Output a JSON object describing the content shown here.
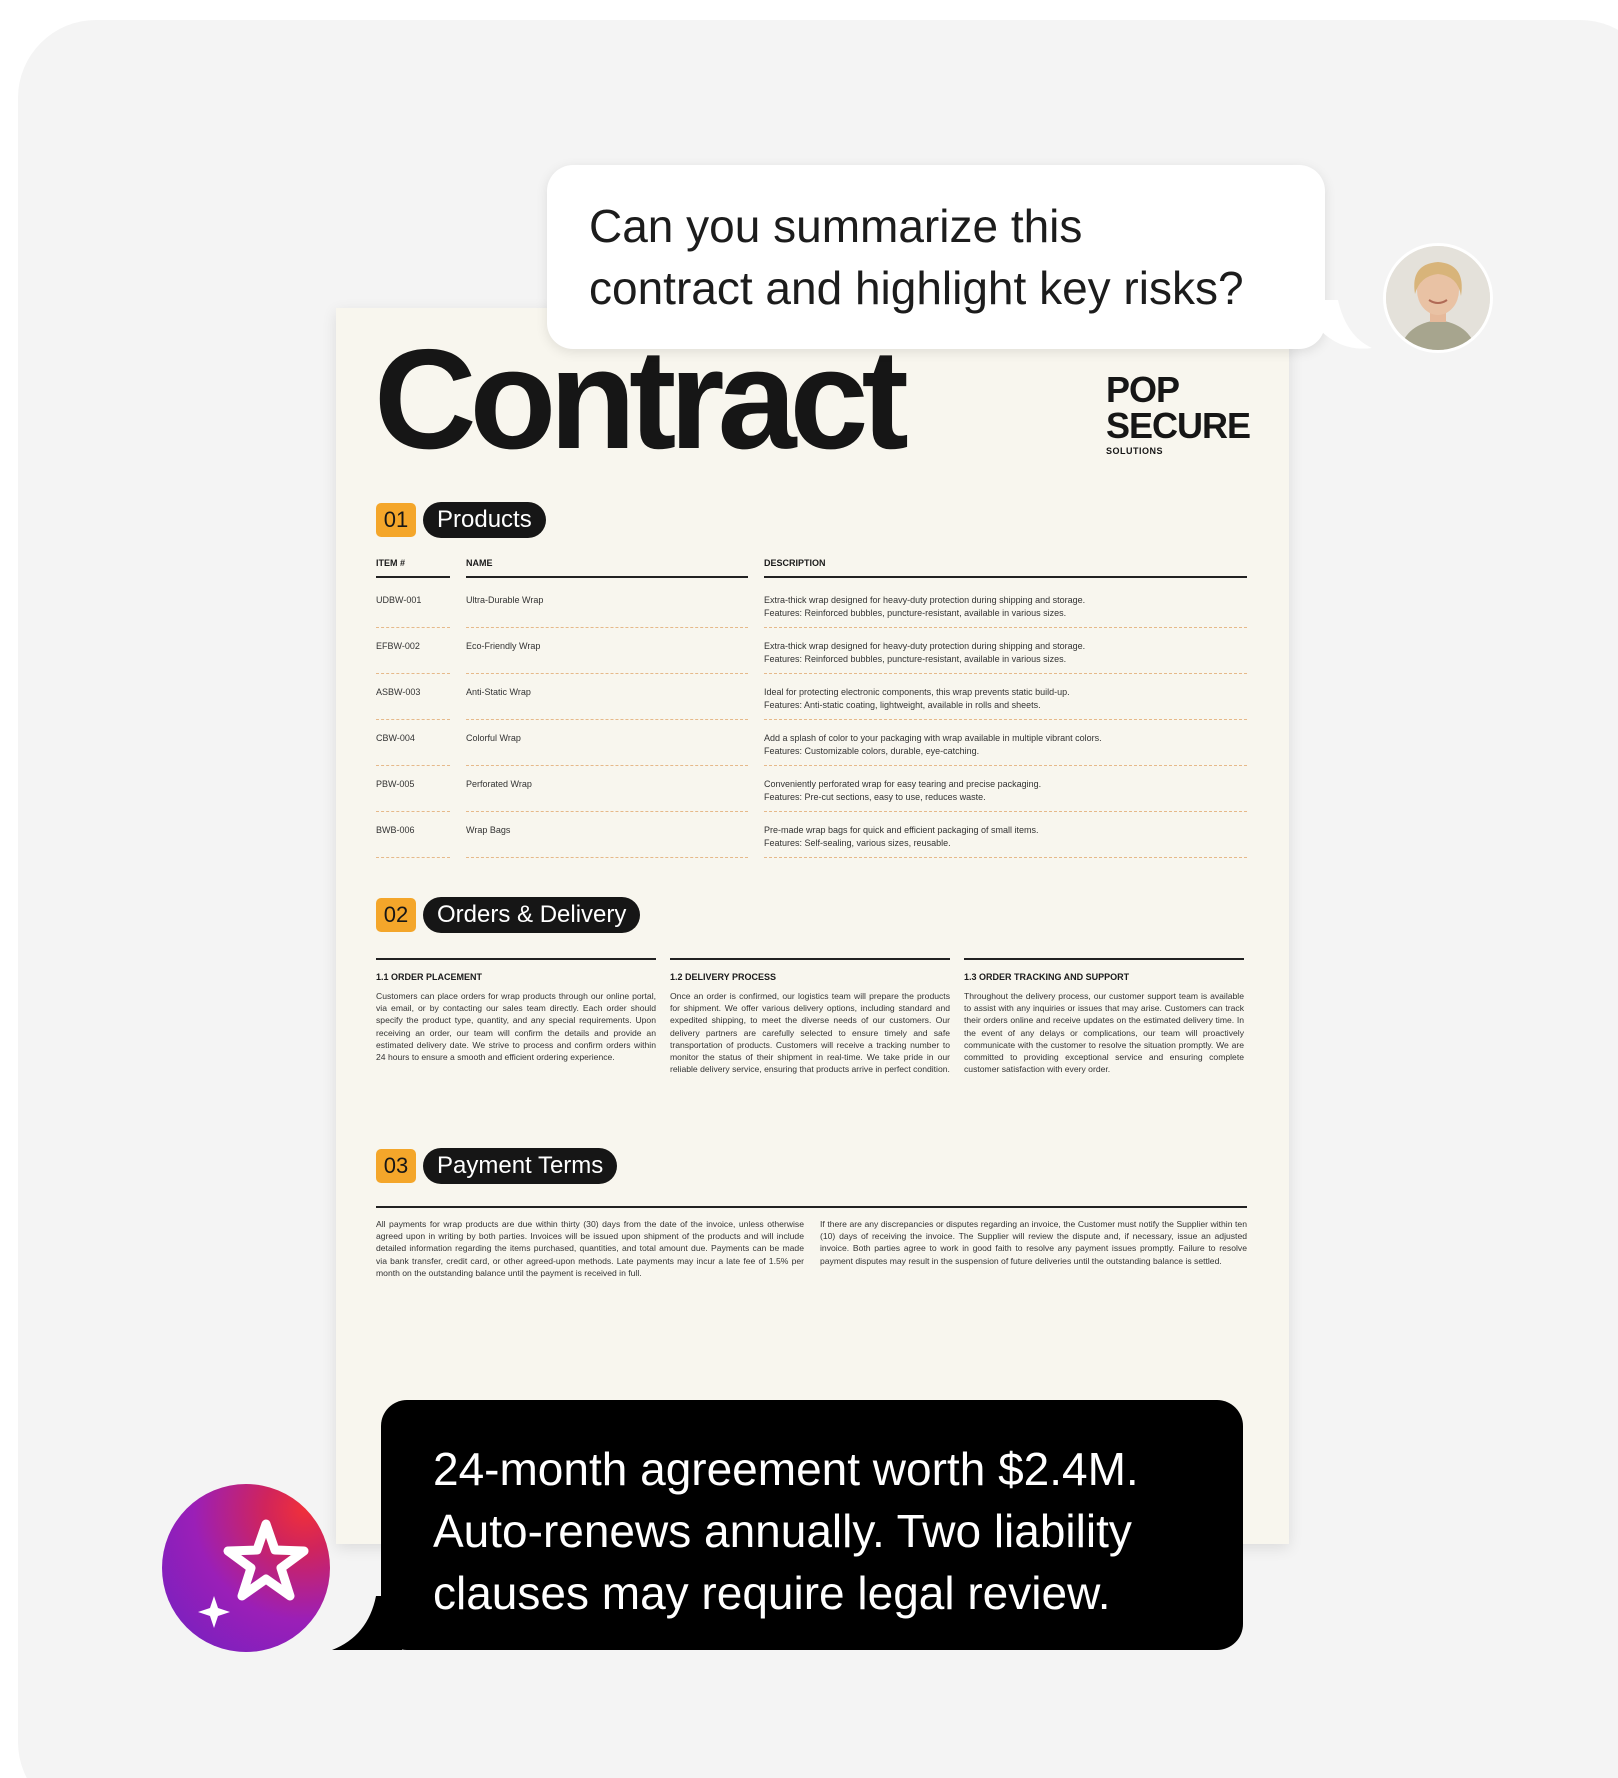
{
  "document": {
    "title": "Contract",
    "logo": {
      "line1": "POP",
      "line2": "SECURE",
      "line3": "SOLUTIONS"
    },
    "sections": [
      {
        "number": "01",
        "title": "Products"
      },
      {
        "number": "02",
        "title": "Orders & Delivery"
      },
      {
        "number": "03",
        "title": "Payment Terms"
      }
    ],
    "products": {
      "headers": [
        "ITEM #",
        "NAME",
        "DESCRIPTION"
      ],
      "rows": [
        {
          "item": "UDBW-001",
          "name": "Ultra-Durable Wrap",
          "desc1": "Extra-thick wrap designed for heavy-duty protection during shipping and storage.",
          "desc2": "Features: Reinforced bubbles, puncture-resistant, available in various sizes."
        },
        {
          "item": "EFBW-002",
          "name": "Eco-Friendly Wrap",
          "desc1": "Extra-thick wrap designed for heavy-duty protection during shipping and storage.",
          "desc2": "Features: Reinforced bubbles, puncture-resistant, available in various sizes."
        },
        {
          "item": "ASBW-003",
          "name": "Anti-Static Wrap",
          "desc1": "Ideal for protecting electronic components, this wrap prevents static build-up.",
          "desc2": "Features: Anti-static coating, lightweight, available in rolls and sheets."
        },
        {
          "item": "CBW-004",
          "name": "Colorful Wrap",
          "desc1": "Add a splash of color to your packaging with wrap available in multiple vibrant colors.",
          "desc2": "Features: Customizable colors, durable, eye-catching."
        },
        {
          "item": "PBW-005",
          "name": "Perforated Wrap",
          "desc1": "Conveniently perforated wrap for easy tearing and precise packaging.",
          "desc2": "Features: Pre-cut sections, easy to use, reduces waste."
        },
        {
          "item": "BWB-006",
          "name": "Wrap Bags",
          "desc1": "Pre-made wrap bags for quick and efficient packaging of small items.",
          "desc2": "Features: Self-sealing, various sizes, reusable."
        }
      ]
    },
    "orders": [
      {
        "title": "1.1  ORDER PLACEMENT",
        "body": "Customers can place orders for wrap products through our online portal, via email, or by contacting our sales team directly. Each order should specify the product type, quantity, and any special requirements. Upon receiving an order, our team will confirm the details and provide an estimated delivery date. We strive to process and confirm orders within 24 hours to ensure a smooth and efficient ordering experience."
      },
      {
        "title": "1.2  DELIVERY PROCESS",
        "body": "Once an order is confirmed, our logistics team will prepare the products for shipment. We offer various delivery options, including standard and expedited shipping, to meet the diverse needs of our customers. Our delivery partners are carefully selected to ensure timely and safe transportation of products. Customers will receive a tracking number to monitor the status of their shipment in real-time. We take pride in our reliable delivery service, ensuring that products arrive in perfect condition."
      },
      {
        "title": "1.3  ORDER TRACKING AND SUPPORT",
        "body": "Throughout the delivery process, our customer support team is available to assist with any inquiries or issues that may arise. Customers can track their orders online and receive updates on the estimated delivery time. In the event of any delays or complications, our team will proactively communicate with the customer to resolve the situation promptly. We are committed to providing exceptional service and ensuring complete customer satisfaction with every order."
      }
    ],
    "payment": [
      "All payments for wrap products are due within thirty (30) days from the date of the invoice, unless otherwise agreed upon in writing by both parties. Invoices will be issued upon shipment of the products and will include detailed information regarding the items purchased, quantities, and total amount due. Payments can be made via bank transfer, credit card, or other agreed-upon methods. Late payments may incur a late fee of 1.5% per month on the outstanding balance until the payment is received in full.",
      "If there are any discrepancies or disputes regarding an invoice, the Customer must notify the Supplier within ten (10) days of receiving the invoice. The Supplier will review the dispute and, if necessary, issue an adjusted invoice. Both parties agree to work in good faith to resolve any payment issues promptly. Failure to resolve payment disputes may result in the suspension of future deliveries until the outstanding balance is settled."
    ]
  },
  "chat": {
    "user_message_line1": "Can you summarize this",
    "user_message_line2": "contract and highlight key risks?",
    "ai_message_line1": "24-month agreement worth $2.4M.",
    "ai_message_line2": "Auto-renews annually. Two liability",
    "ai_message_line3": "clauses may require legal review."
  },
  "colors": {
    "card_bg": "#f4f4f4",
    "doc_bg": "#f8f6ee",
    "accent_orange": "#f4a62a",
    "ai_bubble_bg": "#000000",
    "ai_icon_gradient": [
      "#f0303a",
      "#9b1fb7",
      "#6f20c2"
    ]
  }
}
